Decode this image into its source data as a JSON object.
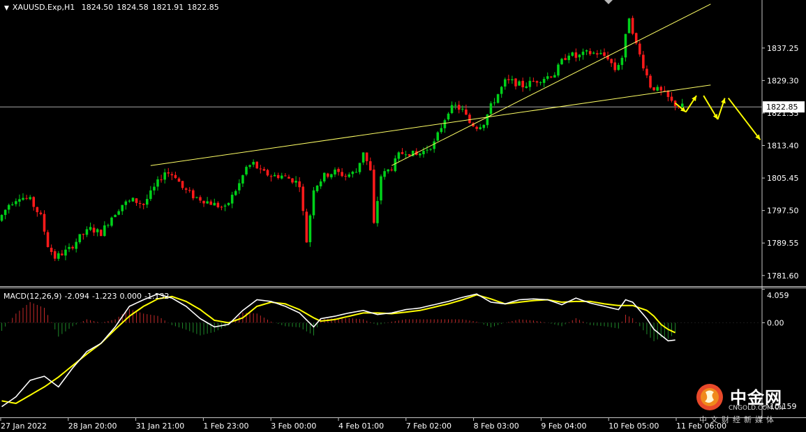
{
  "header": {
    "symbol": "XAUUSD.Exp,H1",
    "open": "1824.50",
    "high": "1824.58",
    "low": "1821.91",
    "close": "1822.85"
  },
  "macd_header": {
    "name": "MACD(12,26,9)",
    "v1": "-2.094",
    "v2": "-1.223",
    "v3": "0.000",
    "v4": "-1.132"
  },
  "watermark": {
    "name_cn": "中金网",
    "name_en": "CNGOLD.COM.CN",
    "tagline": "中文财经新媒体"
  },
  "colors": {
    "background": "#000000",
    "bull": "#00d11a",
    "bear": "#ff1a1a",
    "trendline": "#ffff66",
    "arrow": "#ffff00",
    "macd_line": "#ffffff",
    "signal_line": "#ffff00",
    "grid_line": "#c0c0c0"
  },
  "chart_data": [
    {
      "type": "candlestick",
      "title": "XAUUSD.Exp,H1",
      "y_ticks": [
        "1837.25",
        "1829.30",
        "1821.35",
        "1813.40",
        "1805.45",
        "1797.50",
        "1789.55",
        "1781.60"
      ],
      "ylim": [
        1779.0,
        1849.0
      ],
      "current_price": "1822.85",
      "x_ticks": [
        "27 Jan 2022",
        "28 Jan 20:00",
        "31 Jan 21:00",
        "1 Feb 23:00",
        "3 Feb 00:00",
        "4 Feb 01:00",
        "7 Feb 02:00",
        "8 Feb 03:00",
        "9 Feb 04:00",
        "10 Feb 05:00",
        "11 Feb 06:00"
      ],
      "price_path": [
        [
          0,
          1795
        ],
        [
          3,
          1799
        ],
        [
          6,
          1801
        ],
        [
          9,
          1800
        ],
        [
          12,
          1796
        ],
        [
          14,
          1789
        ],
        [
          16,
          1786
        ],
        [
          18,
          1787
        ],
        [
          20,
          1788
        ],
        [
          23,
          1791
        ],
        [
          26,
          1793
        ],
        [
          29,
          1792
        ],
        [
          32,
          1796
        ],
        [
          35,
          1799
        ],
        [
          38,
          1800
        ],
        [
          41,
          1799
        ],
        [
          44,
          1803
        ],
        [
          47,
          1807
        ],
        [
          50,
          1806
        ],
        [
          52,
          1803
        ],
        [
          55,
          1801
        ],
        [
          58,
          1800
        ],
        [
          61,
          1799
        ],
        [
          64,
          1798
        ],
        [
          66,
          1801
        ],
        [
          68,
          1804
        ],
        [
          70,
          1808
        ],
        [
          72,
          1809
        ],
        [
          74,
          1807
        ],
        [
          77,
          1806
        ],
        [
          80,
          1806
        ],
        [
          83,
          1805
        ],
        [
          85,
          1804
        ],
        [
          87,
          1790
        ],
        [
          89,
          1803
        ],
        [
          92,
          1806
        ],
        [
          95,
          1807
        ],
        [
          98,
          1806
        ],
        [
          101,
          1807
        ],
        [
          103,
          1812
        ],
        [
          105,
          1807
        ],
        [
          106,
          1794
        ],
        [
          108,
          1806
        ],
        [
          111,
          1808
        ],
        [
          113,
          1811
        ],
        [
          115,
          1812
        ],
        [
          118,
          1811
        ],
        [
          120,
          1812
        ],
        [
          123,
          1814
        ],
        [
          125,
          1818
        ],
        [
          127,
          1822
        ],
        [
          129,
          1823
        ],
        [
          131,
          1822
        ],
        [
          133,
          1819
        ],
        [
          135,
          1818
        ],
        [
          137,
          1819
        ],
        [
          139,
          1823
        ],
        [
          141,
          1826
        ],
        [
          143,
          1829
        ],
        [
          145,
          1829
        ],
        [
          148,
          1828
        ],
        [
          151,
          1829
        ],
        [
          154,
          1830
        ],
        [
          157,
          1831
        ],
        [
          159,
          1834
        ],
        [
          161,
          1836
        ],
        [
          163,
          1835
        ],
        [
          166,
          1836
        ],
        [
          169,
          1836
        ],
        [
          172,
          1835
        ],
        [
          174,
          1832
        ],
        [
          176,
          1835
        ],
        [
          178,
          1845
        ],
        [
          180,
          1838
        ],
        [
          182,
          1833
        ],
        [
          184,
          1828
        ],
        [
          186,
          1827
        ],
        [
          188,
          1826
        ],
        [
          190,
          1824
        ],
        [
          192,
          1823
        ]
      ],
      "trendlines": [
        {
          "from": [
            42,
            1808.5
          ],
          "to": [
            200,
            1828.2
          ]
        },
        {
          "from": [
            110,
            1808.5
          ],
          "to": [
            200,
            1848.0
          ]
        }
      ],
      "forecast_arrows": [
        {
          "from": [
            190,
            1823.8
          ],
          "to": [
            193,
            1821.6
          ]
        },
        {
          "from": [
            193,
            1821.6
          ],
          "to": [
            196,
            1825.6
          ]
        },
        {
          "from": [
            198,
            1825.6
          ],
          "to": [
            202,
            1819.8
          ]
        },
        {
          "from": [
            202,
            1819.8
          ],
          "to": [
            204,
            1825.0
          ]
        },
        {
          "from": [
            205,
            1825.0
          ],
          "to": [
            214,
            1814.8
          ]
        }
      ]
    },
    {
      "type": "macd",
      "title": "MACD(12,26,9)",
      "y_ticks": [
        "4.059",
        "0.00",
        "-10.159"
      ],
      "ylim": [
        -11.5,
        4.2
      ],
      "macd": [
        [
          0,
          -10.2
        ],
        [
          4,
          -9.0
        ],
        [
          8,
          -7.0
        ],
        [
          12,
          -6.5
        ],
        [
          16,
          -7.8
        ],
        [
          20,
          -5.5
        ],
        [
          24,
          -3.5
        ],
        [
          28,
          -2.5
        ],
        [
          32,
          -0.5
        ],
        [
          36,
          2.0
        ],
        [
          40,
          2.8
        ],
        [
          44,
          3.5
        ],
        [
          48,
          3.0
        ],
        [
          52,
          2.0
        ],
        [
          56,
          0.5
        ],
        [
          60,
          -0.5
        ],
        [
          64,
          -0.2
        ],
        [
          68,
          1.5
        ],
        [
          72,
          2.8
        ],
        [
          76,
          2.6
        ],
        [
          80,
          2.0
        ],
        [
          84,
          1.2
        ],
        [
          88,
          -0.5
        ],
        [
          90,
          0.5
        ],
        [
          94,
          0.8
        ],
        [
          98,
          1.2
        ],
        [
          102,
          1.5
        ],
        [
          106,
          1.0
        ],
        [
          110,
          1.2
        ],
        [
          114,
          1.6
        ],
        [
          118,
          1.8
        ],
        [
          122,
          2.2
        ],
        [
          126,
          2.6
        ],
        [
          130,
          3.1
        ],
        [
          134,
          3.5
        ],
        [
          138,
          2.5
        ],
        [
          142,
          2.3
        ],
        [
          146,
          2.8
        ],
        [
          150,
          2.9
        ],
        [
          154,
          2.8
        ],
        [
          158,
          2.2
        ],
        [
          162,
          3.0
        ],
        [
          166,
          2.4
        ],
        [
          170,
          2.0
        ],
        [
          174,
          1.6
        ],
        [
          176,
          2.8
        ],
        [
          178,
          2.5
        ],
        [
          180,
          1.5
        ],
        [
          182,
          0.5
        ],
        [
          184,
          -0.8
        ],
        [
          186,
          -1.5
        ],
        [
          188,
          -2.2
        ],
        [
          190,
          -2.1
        ]
      ],
      "signal": [
        [
          0,
          -9.5
        ],
        [
          4,
          -9.8
        ],
        [
          8,
          -8.8
        ],
        [
          12,
          -7.8
        ],
        [
          16,
          -6.6
        ],
        [
          20,
          -5.2
        ],
        [
          24,
          -3.8
        ],
        [
          28,
          -2.5
        ],
        [
          32,
          -0.8
        ],
        [
          36,
          0.8
        ],
        [
          40,
          2.0
        ],
        [
          44,
          2.9
        ],
        [
          48,
          3.2
        ],
        [
          52,
          2.6
        ],
        [
          56,
          1.6
        ],
        [
          60,
          0.3
        ],
        [
          64,
          0.0
        ],
        [
          68,
          0.6
        ],
        [
          72,
          2.0
        ],
        [
          76,
          2.5
        ],
        [
          80,
          2.3
        ],
        [
          84,
          1.6
        ],
        [
          88,
          0.6
        ],
        [
          90,
          0.2
        ],
        [
          94,
          0.4
        ],
        [
          98,
          0.8
        ],
        [
          102,
          1.2
        ],
        [
          106,
          1.2
        ],
        [
          110,
          1.1
        ],
        [
          114,
          1.3
        ],
        [
          118,
          1.5
        ],
        [
          122,
          1.9
        ],
        [
          126,
          2.3
        ],
        [
          130,
          2.8
        ],
        [
          134,
          3.4
        ],
        [
          138,
          2.9
        ],
        [
          142,
          2.3
        ],
        [
          146,
          2.5
        ],
        [
          150,
          2.7
        ],
        [
          154,
          2.8
        ],
        [
          158,
          2.5
        ],
        [
          162,
          2.6
        ],
        [
          166,
          2.6
        ],
        [
          170,
          2.3
        ],
        [
          174,
          2.1
        ],
        [
          178,
          2.1
        ],
        [
          182,
          1.5
        ],
        [
          184,
          0.8
        ],
        [
          186,
          -0.2
        ],
        [
          188,
          -0.8
        ],
        [
          190,
          -1.2
        ]
      ]
    }
  ]
}
